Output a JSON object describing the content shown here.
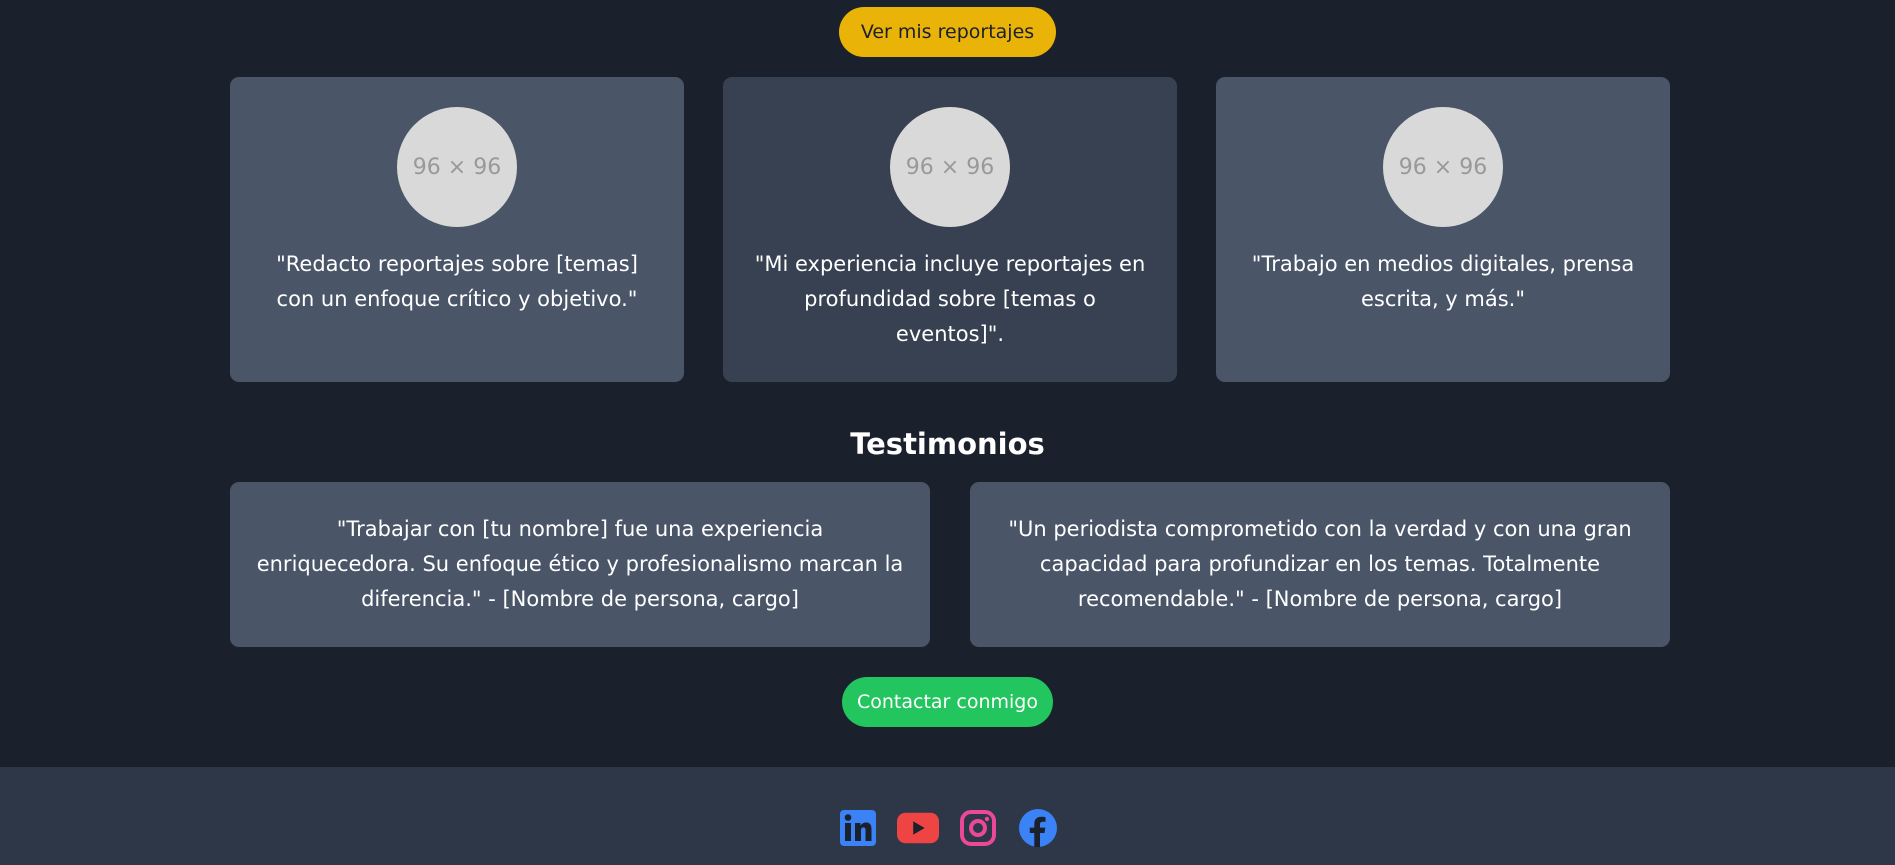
{
  "buttons": {
    "reports": "Ver mis reportajes",
    "contact": "Contactar conmigo"
  },
  "cards": [
    {
      "avatar": "96 × 96",
      "text": "\"Redacto reportajes sobre [temas] con un enfoque crítico y objetivo.\""
    },
    {
      "avatar": "96 × 96",
      "text": "\"Mi experiencia incluye reportajes en profundidad sobre [temas o eventos]\"."
    },
    {
      "avatar": "96 × 96",
      "text": "\"Trabajo en medios digitales, prensa escrita, y más.\""
    }
  ],
  "testimonials": {
    "title": "Testimonios",
    "items": [
      "\"Trabajar con [tu nombre] fue una experiencia enriquecedora. Su enfoque ético y profesionalismo marcan la diferencia.\" - [Nombre de persona, cargo]",
      "\"Un periodista comprometido con la verdad y con una gran capacidad para profundizar en los temas. Totalmente recomendable.\" - [Nombre de persona, cargo]"
    ]
  },
  "footer": {
    "social_icons": [
      "linkedin-icon",
      "youtube-icon",
      "instagram-icon",
      "facebook-icon"
    ]
  },
  "colors": {
    "background": "#1a202c",
    "card": "#4a5568",
    "card_alt": "#374151",
    "footer": "#2d3748",
    "reports_button": "#eab308",
    "contact_button": "#22c55e",
    "linkedin": "#3b82f6",
    "youtube": "#ef4444",
    "instagram": "#ec4899",
    "facebook": "#3b82f6"
  }
}
